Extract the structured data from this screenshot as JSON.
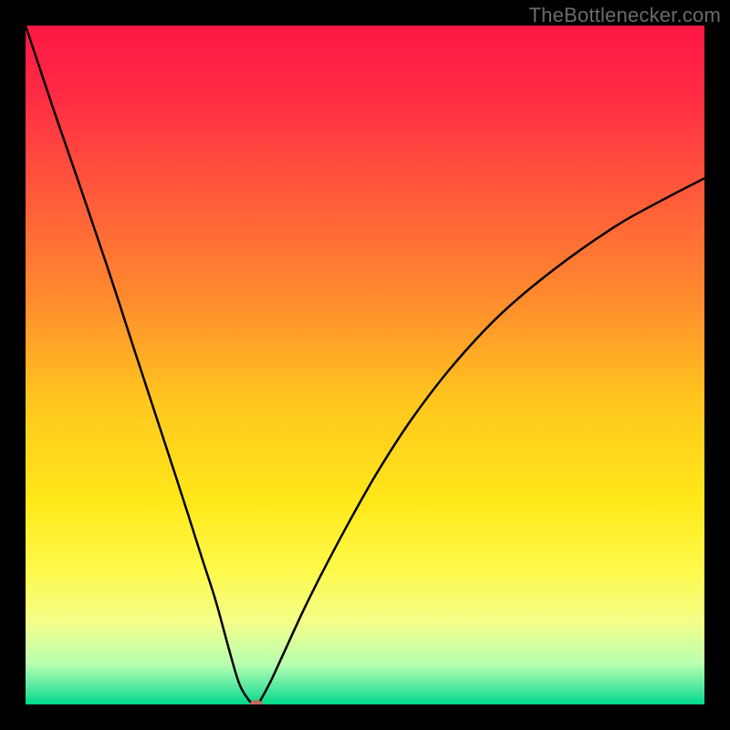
{
  "attribution": "TheBottlenecker.com",
  "chart_data": {
    "type": "line",
    "title": "",
    "xlabel": "",
    "ylabel": "",
    "xlim": [
      0,
      100
    ],
    "ylim": [
      0,
      100
    ],
    "gradient_stops": [
      {
        "offset": 0.0,
        "color": "#ff1744"
      },
      {
        "offset": 0.1,
        "color": "#ff2b44"
      },
      {
        "offset": 0.25,
        "color": "#ff5a3a"
      },
      {
        "offset": 0.4,
        "color": "#ff8a2e"
      },
      {
        "offset": 0.55,
        "color": "#ffc51e"
      },
      {
        "offset": 0.7,
        "color": "#ffe81a"
      },
      {
        "offset": 0.8,
        "color": "#fff94a"
      },
      {
        "offset": 0.88,
        "color": "#f3ff8a"
      },
      {
        "offset": 0.94,
        "color": "#b8ffb0"
      },
      {
        "offset": 0.975,
        "color": "#53e8a0"
      },
      {
        "offset": 1.0,
        "color": "#00d98a"
      }
    ],
    "series": [
      {
        "name": "bottleneck-curve",
        "x": [
          0,
          2,
          4,
          6,
          8,
          10,
          12,
          14,
          16,
          18,
          20,
          22,
          24,
          26,
          28,
          30,
          31.5,
          33,
          33.8,
          34.2,
          36,
          38,
          41,
          44,
          48,
          52,
          57,
          63,
          70,
          78,
          87,
          94,
          100
        ],
        "values": [
          100,
          94,
          88,
          82.2,
          76.4,
          70.5,
          64.6,
          58.5,
          52.3,
          46.2,
          40.1,
          34.0,
          27.8,
          21.5,
          15.3,
          8.0,
          3.0,
          0.5,
          0.0,
          0.0,
          3.2,
          7.5,
          14.0,
          20.0,
          27.5,
          34.5,
          42.2,
          50.0,
          57.5,
          64.2,
          70.5,
          74.4,
          77.5
        ]
      }
    ],
    "marker": {
      "x": 34,
      "y": 0,
      "color": "#c06a5a",
      "rx": 7,
      "ry": 5
    }
  }
}
